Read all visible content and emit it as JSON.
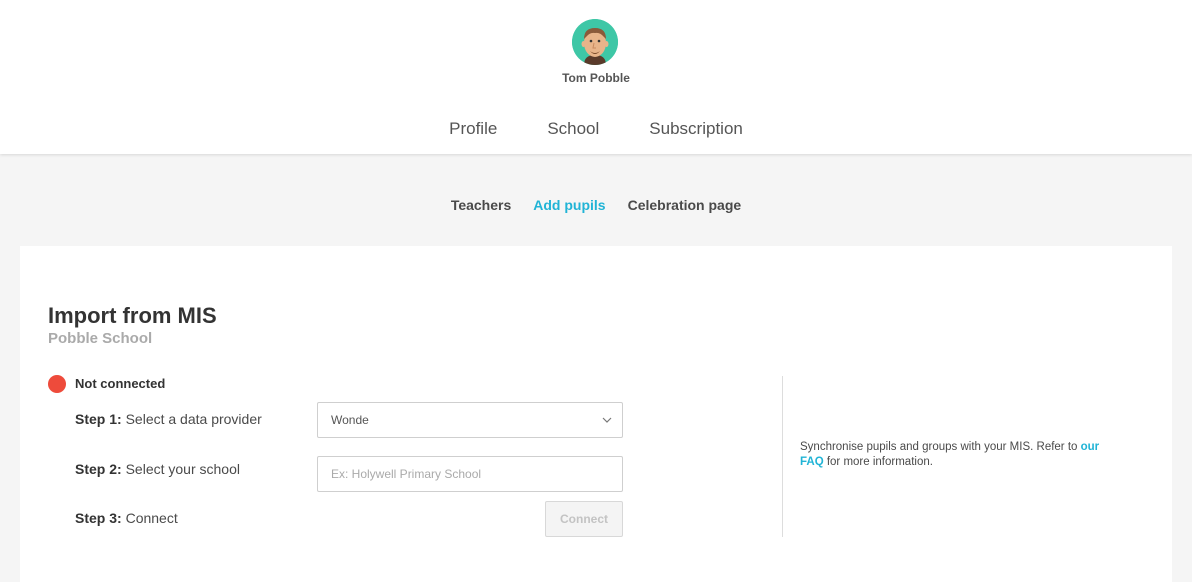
{
  "user": {
    "name": "Tom Pobble"
  },
  "main_nav": {
    "tabs": [
      {
        "label": "Profile"
      },
      {
        "label": "School"
      },
      {
        "label": "Subscription"
      }
    ]
  },
  "sub_nav": {
    "tabs": [
      {
        "label": "Teachers",
        "active": false
      },
      {
        "label": "Add pupils",
        "active": true
      },
      {
        "label": "Celebration page",
        "active": false
      }
    ]
  },
  "import": {
    "title": "Import from MIS",
    "school_name": "Pobble School",
    "status": "Not connected",
    "status_color": "#ee4b3b",
    "steps": [
      {
        "number": "Step 1:",
        "text": "Select a data provider"
      },
      {
        "number": "Step 2:",
        "text": "Select your school"
      },
      {
        "number": "Step 3:",
        "text": "Connect"
      }
    ],
    "provider_select": {
      "value": "Wonde",
      "icon": "chevron-down-icon"
    },
    "school_input": {
      "value": "",
      "placeholder": "Ex: Holywell Primary School"
    },
    "connect_label": "Connect",
    "info_text": "Synchronise pupils and groups with your MIS. Refer to",
    "info_link_1": "our",
    "info_link_2": "FAQ",
    "info_text_end": "for more information."
  },
  "colors": {
    "accent": "#21b4d6",
    "avatar_bg": "#3ec7a6"
  }
}
